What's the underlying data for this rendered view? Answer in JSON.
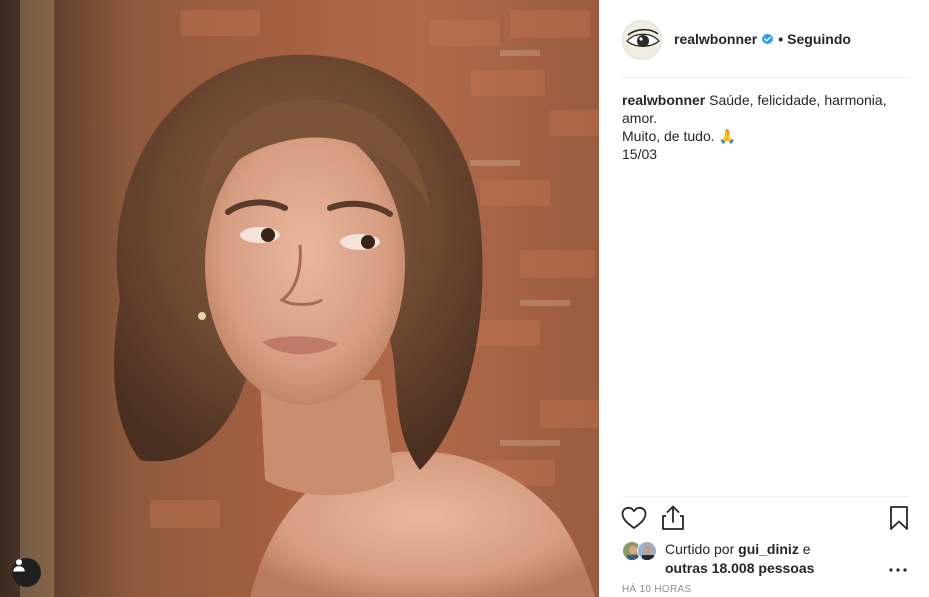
{
  "post": {
    "username": "realwbonner",
    "follow_separator": "•",
    "follow_state": "Seguindo",
    "caption": {
      "username": "realwbonner",
      "line1": "Saúde, felicidade, harmonia, amor.",
      "line2": "Muito, de tudo. 🙏",
      "line3": "15/03"
    },
    "likes": {
      "prefix": "Curtido por",
      "first_liker": "gui_diniz",
      "joiner": "e",
      "others": "outras 18.008 pessoas"
    },
    "timestamp": "Há 10 horas"
  },
  "icons": {
    "verified": "verified-badge-icon",
    "like": "heart-icon",
    "share": "share-icon",
    "save": "bookmark-icon",
    "more": "more-options-icon",
    "tag_user": "user-tag-icon"
  },
  "colors": {
    "verified_blue": "#3897f0",
    "text": "#262626",
    "muted": "#8e8e8e",
    "divider": "#efefef"
  }
}
